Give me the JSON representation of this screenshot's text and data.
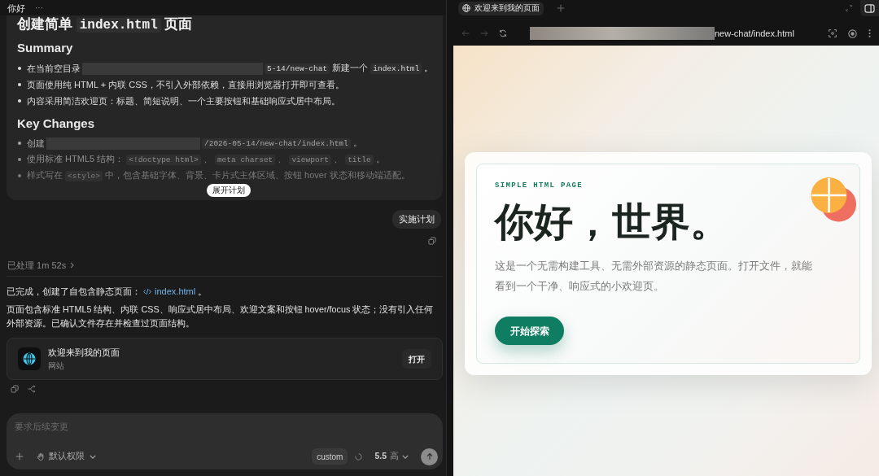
{
  "window": {
    "title": "你好",
    "more": "···"
  },
  "plan": {
    "collapsed": true,
    "heading": [
      {
        "kind": "text",
        "text": "创建简单 "
      },
      {
        "kind": "code",
        "text": "index.html"
      },
      {
        "kind": "text",
        "text": " 页面"
      }
    ],
    "sections": [
      {
        "title": "Summary",
        "items": [
          [
            {
              "kind": "text",
              "text": "在当前空目录"
            },
            {
              "kind": "redacted"
            },
            {
              "kind": "code",
              "text": "5-14/new-chat"
            },
            {
              "kind": "text",
              "text": " 新建一个 "
            },
            {
              "kind": "code",
              "text": "index.html"
            },
            {
              "kind": "text",
              "text": " 。"
            }
          ],
          [
            {
              "kind": "text",
              "text": "页面使用纯 HTML + 内联 CSS，不引入外部依赖，直接用浏览器打开即可查看。"
            }
          ],
          [
            {
              "kind": "text",
              "text": "内容采用简洁欢迎页：标题、简短说明、一个主要按钮和基础响应式居中布局。"
            }
          ]
        ]
      },
      {
        "title": "Key Changes",
        "items": [
          [
            {
              "kind": "text",
              "text": "创建"
            },
            {
              "kind": "redacted"
            },
            {
              "kind": "code",
              "text": "/2026-05-14/new-chat/index.html"
            },
            {
              "kind": "text",
              "text": " 。"
            }
          ],
          [
            {
              "kind": "text",
              "text": "使用标准 HTML5 结构： "
            },
            {
              "kind": "code",
              "text": "<!doctype html>"
            },
            {
              "kind": "text",
              "text": " 、 "
            },
            {
              "kind": "code",
              "text": "meta charset"
            },
            {
              "kind": "text",
              "text": " 、 "
            },
            {
              "kind": "code",
              "text": "viewport"
            },
            {
              "kind": "text",
              "text": " 、 "
            },
            {
              "kind": "code",
              "text": "title"
            },
            {
              "kind": "text",
              "text": " 。"
            }
          ],
          [
            {
              "kind": "text",
              "text": "样式写在 "
            },
            {
              "kind": "code",
              "text": "<style>"
            },
            {
              "kind": "text",
              "text": " 中，包含基础字体、背景、卡片式主体区域、按钮 hover 状态和移动端适配。"
            }
          ]
        ]
      }
    ],
    "expand_button": "展开计划"
  },
  "user_message": "实施计划",
  "processed": "已处理 1m 52s",
  "reply": {
    "summary": [
      {
        "kind": "text",
        "text": "已完成，创建了自包含静态页面： "
      },
      {
        "kind": "file",
        "text": "index.html"
      },
      {
        "kind": "text",
        "text": " 。"
      }
    ],
    "details": "页面包含标准 HTML5 结构、内联 CSS、响应式居中布局、欢迎文案和按钮 hover/focus 状态；没有引入任何外部资源。已确认文件存在并检查过页面结构。"
  },
  "preview_card": {
    "title": "欢迎来到我的页面",
    "subtitle": "网站",
    "button": "打开"
  },
  "composer": {
    "placeholder": "要求后续变更",
    "permission": "默认权限",
    "mode": "custom",
    "model": "5.5",
    "effort": "高"
  },
  "browser": {
    "tab": {
      "title": "欢迎来到我的页面",
      "selected": true
    },
    "url": "new-chat/index.html"
  },
  "page": {
    "eyebrow": "SIMPLE HTML PAGE",
    "title": "你好，世界。",
    "description": "这是一个无需构建工具、无需外部资源的静态页面。打开文件，就能看到一个干净、响应式的小欢迎页。",
    "button": "开始探索"
  }
}
